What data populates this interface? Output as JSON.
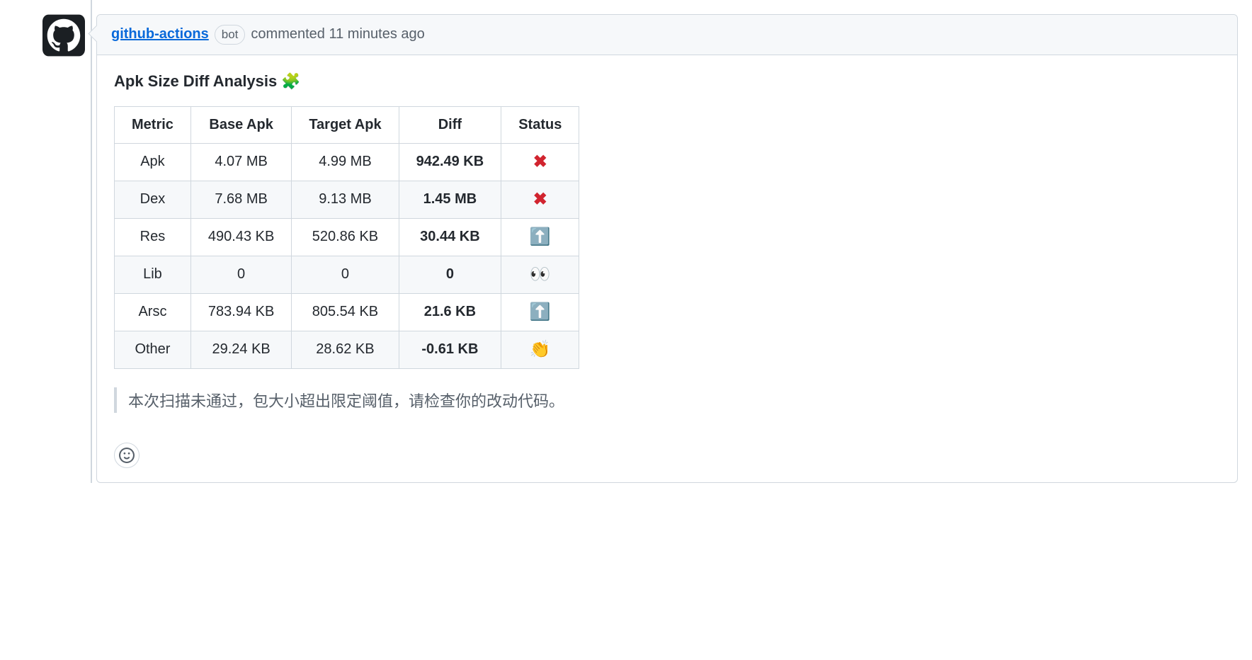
{
  "header": {
    "author": "github-actions",
    "badge": "bot",
    "action": "commented",
    "timestamp": "11 minutes ago"
  },
  "body": {
    "title": "Apk Size Diff Analysis",
    "title_emoji": "🧩",
    "columns": [
      "Metric",
      "Base Apk",
      "Target Apk",
      "Diff",
      "Status"
    ],
    "rows": [
      {
        "metric": "Apk",
        "base": "4.07 MB",
        "target": "4.99 MB",
        "diff": "942.49 KB",
        "status": "❌"
      },
      {
        "metric": "Dex",
        "base": "7.68 MB",
        "target": "9.13 MB",
        "diff": "1.45 MB",
        "status": "❌"
      },
      {
        "metric": "Res",
        "base": "490.43 KB",
        "target": "520.86 KB",
        "diff": "30.44 KB",
        "status": "⬆️"
      },
      {
        "metric": "Lib",
        "base": "0",
        "target": "0",
        "diff": "0",
        "status": "👀"
      },
      {
        "metric": "Arsc",
        "base": "783.94 KB",
        "target": "805.54 KB",
        "diff": "21.6 KB",
        "status": "⬆️"
      },
      {
        "metric": "Other",
        "base": "29.24 KB",
        "target": "28.62 KB",
        "diff": "-0.61 KB",
        "status": "👏"
      }
    ],
    "note": "本次扫描未通过，包大小超出限定阈值，请检查你的改动代码。"
  }
}
